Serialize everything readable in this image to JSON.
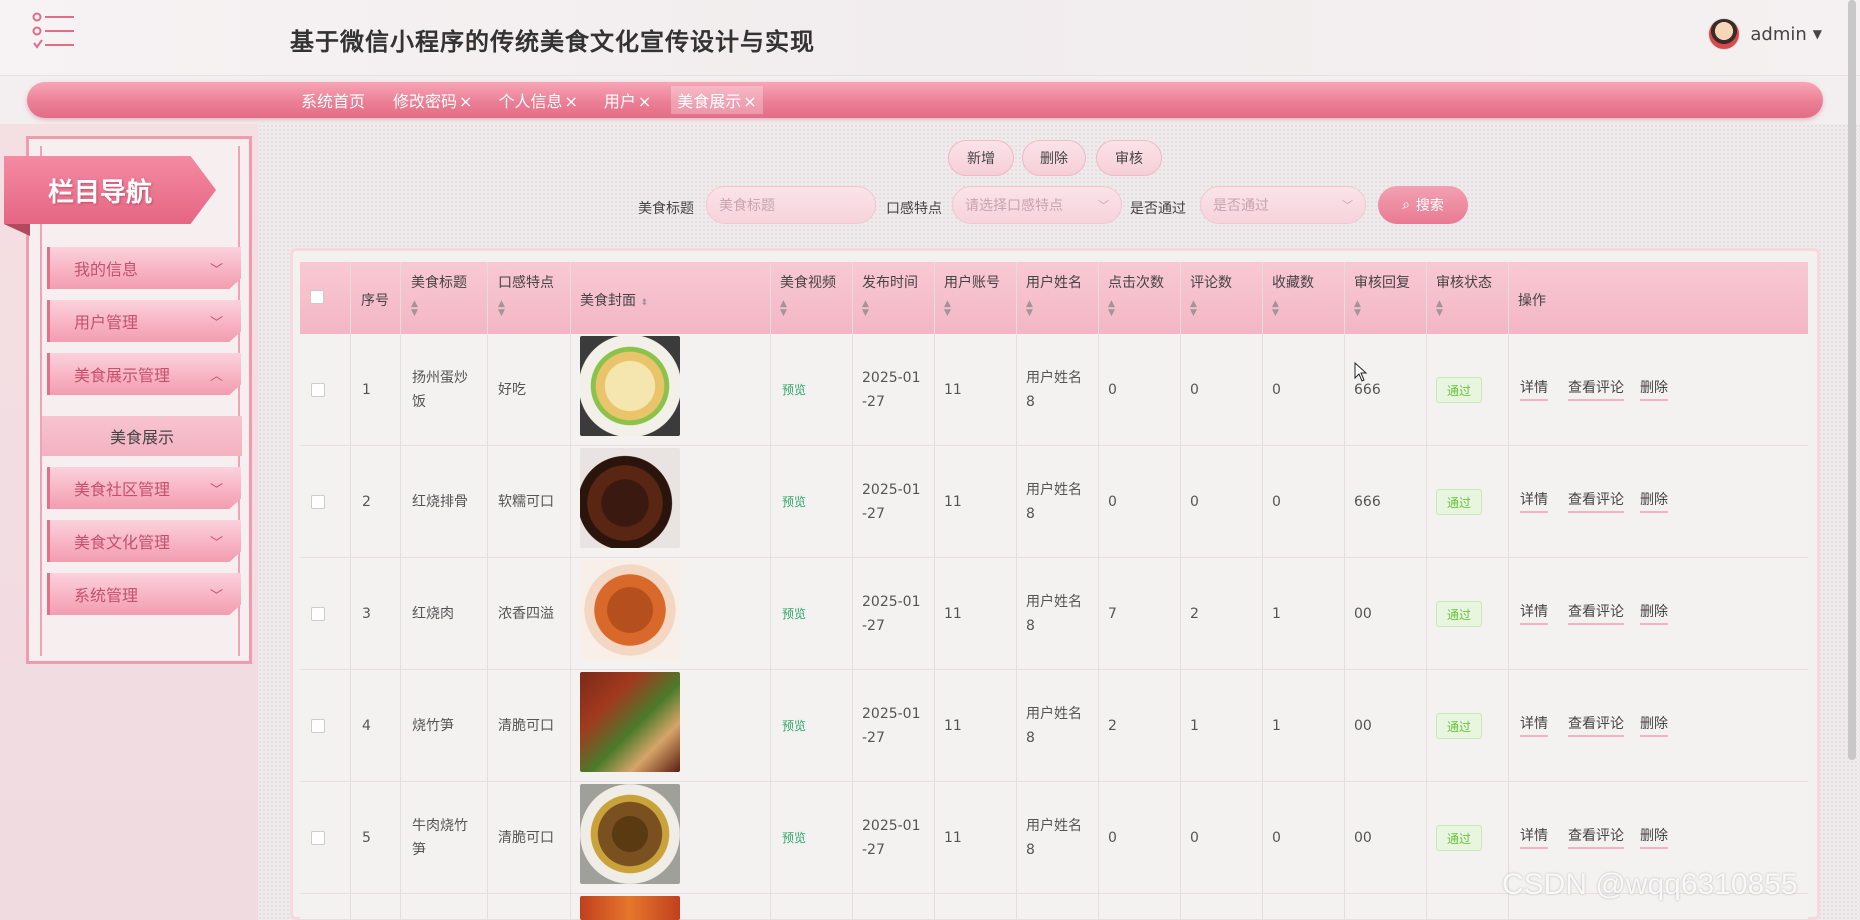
{
  "header": {
    "title": "基于微信小程序的传统美食文化宣传设计与实现",
    "user": "admin"
  },
  "tabs": [
    {
      "label": "系统首页",
      "closable": ""
    },
    {
      "label": "修改密码",
      "closable": "×"
    },
    {
      "label": "个人信息",
      "closable": "×"
    },
    {
      "label": "用户",
      "closable": "×"
    },
    {
      "label": "美食展示",
      "closable": "×"
    }
  ],
  "sidebar": {
    "header": "栏目导航",
    "items": [
      {
        "label": "我的信息"
      },
      {
        "label": "用户管理"
      },
      {
        "label": "美食展示管理"
      },
      {
        "label": "美食展示"
      },
      {
        "label": "美食社区管理"
      },
      {
        "label": "美食文化管理"
      },
      {
        "label": "系统管理"
      }
    ]
  },
  "toolbar": {
    "add": "新增",
    "delete": "删除",
    "audit": "审核"
  },
  "search": {
    "title_label": "美食标题",
    "title_placeholder": "美食标题",
    "taste_label": "口感特点",
    "taste_placeholder": "请选择口感特点",
    "pass_label": "是否通过",
    "pass_placeholder": "是否通过",
    "button": "搜索"
  },
  "table": {
    "headers": [
      "序号",
      "美食标题",
      "口感特点",
      "美食封面",
      "美食视频",
      "发布时间",
      "用户账号",
      "用户姓名",
      "点击次数",
      "评论数",
      "收藏数",
      "审核回复",
      "审核状态",
      "操作"
    ],
    "preview_label": "预览",
    "ops": [
      "详情",
      "查看评论",
      "删除"
    ],
    "rows": [
      {
        "index": "1",
        "title1": "扬州蛋炒",
        "title2": "饭",
        "taste": "好吃",
        "time1": "2025-01",
        "time2": "-27",
        "account": "11",
        "name1": "用户姓名",
        "name2": "8",
        "clicks": "0",
        "comments": "0",
        "favorites": "0",
        "reply": "666",
        "status": "通过"
      },
      {
        "index": "2",
        "title1": "红烧排骨",
        "title2": "",
        "taste": "软糯可口",
        "time1": "2025-01",
        "time2": "-27",
        "account": "11",
        "name1": "用户姓名",
        "name2": "8",
        "clicks": "0",
        "comments": "0",
        "favorites": "0",
        "reply": "666",
        "status": "通过"
      },
      {
        "index": "3",
        "title1": "红烧肉",
        "title2": "",
        "taste": "浓香四溢",
        "time1": "2025-01",
        "time2": "-27",
        "account": "11",
        "name1": "用户姓名",
        "name2": "8",
        "clicks": "7",
        "comments": "2",
        "favorites": "1",
        "reply": "00",
        "status": "通过"
      },
      {
        "index": "4",
        "title1": "烧竹笋",
        "title2": "",
        "taste": "清脆可口",
        "time1": "2025-01",
        "time2": "-27",
        "account": "11",
        "name1": "用户姓名",
        "name2": "8",
        "clicks": "2",
        "comments": "1",
        "favorites": "1",
        "reply": "00",
        "status": "通过"
      },
      {
        "index": "5",
        "title1": "牛肉烧竹",
        "title2": "笋",
        "taste": "清脆可口",
        "time1": "2025-01",
        "time2": "-27",
        "account": "11",
        "name1": "用户姓名",
        "name2": "8",
        "clicks": "0",
        "comments": "0",
        "favorites": "0",
        "reply": "00",
        "status": "通过"
      }
    ]
  },
  "watermark": "CSDN @wqq6310855",
  "colors": {
    "accent": "#e87a92",
    "nav_text": "#c7506d",
    "pass_green": "#67c23a",
    "preview_green": "#2fa86d"
  }
}
